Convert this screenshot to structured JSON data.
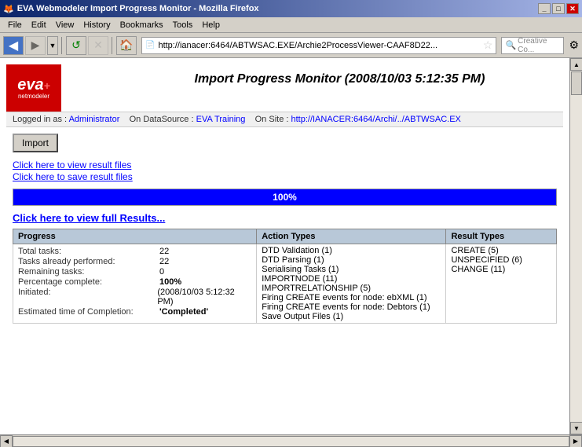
{
  "titlebar": {
    "title": "EVA Webmodeler Import Progress Monitor - Mozilla Firefox",
    "icon": "🦊"
  },
  "menu": {
    "items": [
      "File",
      "Edit",
      "View",
      "History",
      "Bookmarks",
      "Tools",
      "Help"
    ]
  },
  "toolbar": {
    "address": "http://ianacer:6464/ABTWSAC.EXE/Archie2ProcessViewer-CAAF8D22...",
    "search_placeholder": "Creative Co..."
  },
  "header": {
    "title": "Import Progress Monitor (2008/10/03 5:12:35 PM)"
  },
  "info": {
    "logged_in_label": "Logged in as :",
    "logged_in_value": "Administrator",
    "datasource_label": "On DataSource :",
    "datasource_value": "EVA Training",
    "site_label": "On Site :",
    "site_value": "http://IANACER:6464/Archi/../ABTWSAC.EX"
  },
  "import": {
    "button_label": "Import",
    "view_results_link": "Click here to view result files",
    "save_results_link": "Click here to save result files",
    "progress_pct": "100%",
    "progress_value": 100,
    "full_results_link": "Click here to view full Results..."
  },
  "progress_table": {
    "header": "Progress",
    "rows": [
      {
        "label": "Total tasks:",
        "value": "22"
      },
      {
        "label": "Tasks already performed:",
        "value": "22"
      },
      {
        "label": "Remaining tasks:",
        "value": "0"
      },
      {
        "label": "Percentage complete:",
        "value": "100%",
        "bold": true
      },
      {
        "label": "Initiated:",
        "value": "(2008/10/03 5:12:32 PM)"
      },
      {
        "label": "Estimated time of Completion:",
        "value": "'Completed'",
        "bold": true
      }
    ]
  },
  "action_table": {
    "header": "Action Types",
    "rows": [
      "DTD Validation (1)",
      "DTD Parsing (1)",
      "Serialising Tasks (1)",
      "IMPORTNODE (11)",
      "IMPORTRELATIONSHIP (5)",
      "Firing CREATE events for node: ebXML (1)",
      "Firing CREATE events for node: Debtors (1)",
      "Save Output Files (1)"
    ]
  },
  "result_table": {
    "header": "Result Types",
    "rows": [
      "CREATE (5)",
      "UNSPECIFIED (6)",
      "CHANGE (11)"
    ]
  }
}
